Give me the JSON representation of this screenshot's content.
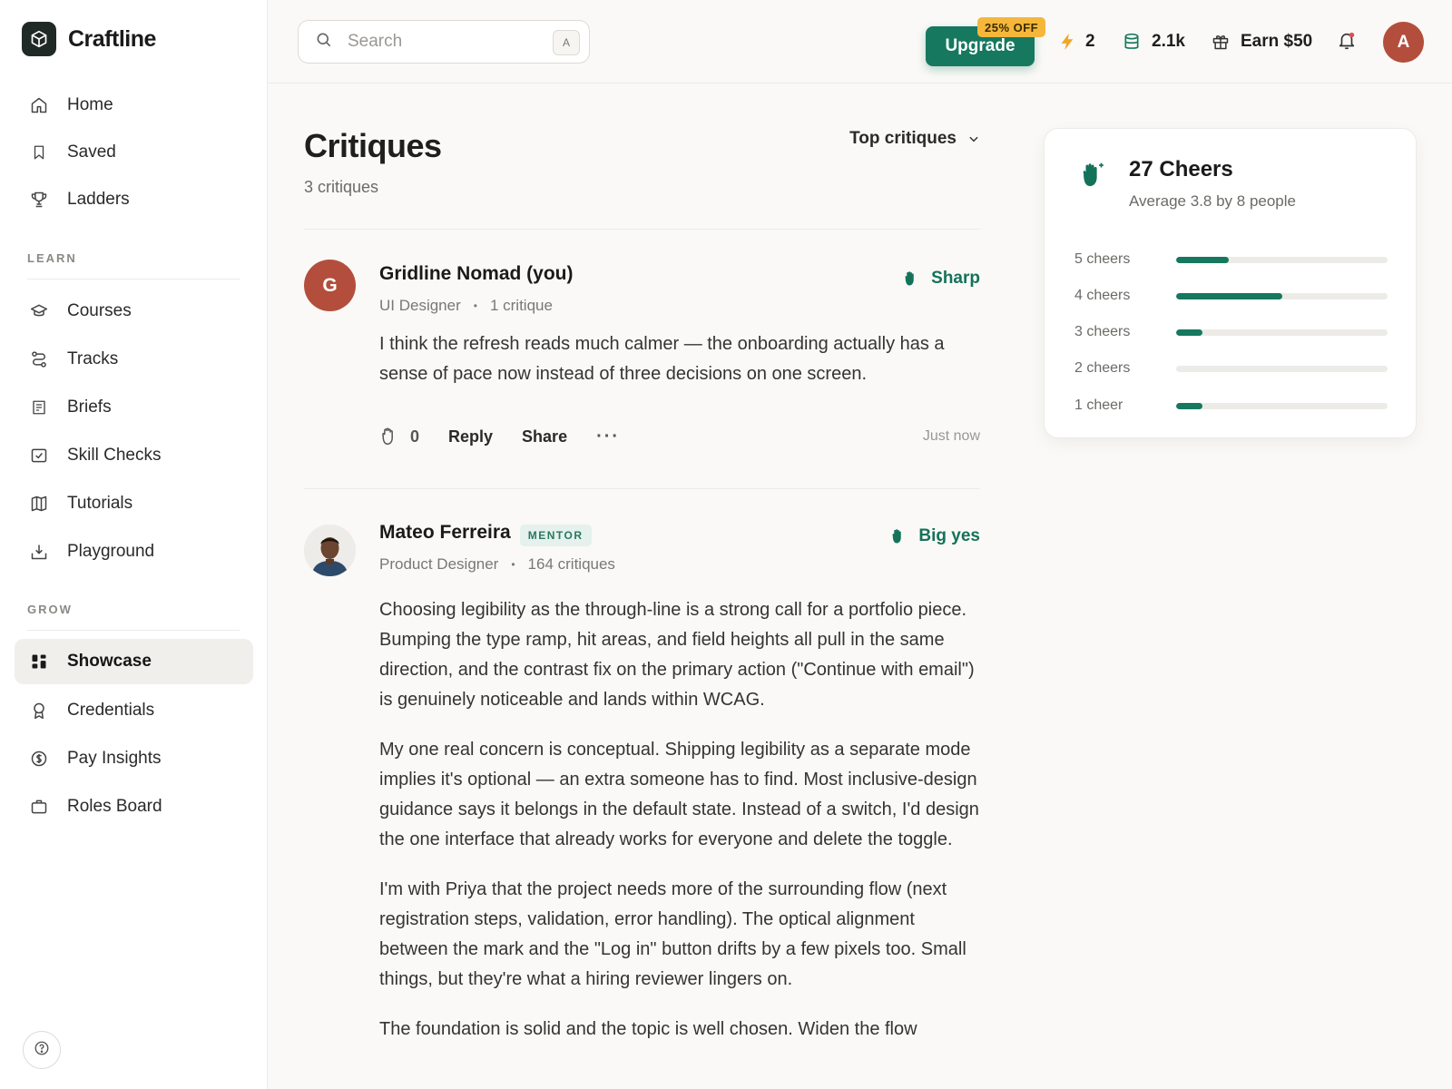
{
  "app": {
    "name": "Craftline"
  },
  "sidebar": {
    "nav_top": [
      {
        "label": "Home",
        "icon": "home-icon"
      },
      {
        "label": "Saved",
        "icon": "bookmark-icon"
      },
      {
        "label": "Ladders",
        "icon": "trophy-icon"
      }
    ],
    "section_learn": "LEARN",
    "nav_learn": [
      {
        "label": "Courses",
        "icon": "graduation-cap-icon"
      },
      {
        "label": "Tracks",
        "icon": "route-icon"
      },
      {
        "label": "Briefs",
        "icon": "document-icon"
      },
      {
        "label": "Skill Checks",
        "icon": "checkbox-icon"
      },
      {
        "label": "Tutorials",
        "icon": "map-icon"
      },
      {
        "label": "Playground",
        "icon": "upload-tray-icon"
      }
    ],
    "section_grow": "GROW",
    "nav_grow": [
      {
        "label": "Showcase",
        "icon": "grid-icon",
        "active": true
      },
      {
        "label": "Credentials",
        "icon": "award-icon"
      },
      {
        "label": "Pay Insights",
        "icon": "dollar-circle-icon"
      },
      {
        "label": "Roles Board",
        "icon": "briefcase-icon"
      }
    ]
  },
  "topbar": {
    "search_placeholder": "Search",
    "search_shortcut": "A",
    "upgrade_label": "Upgrade",
    "upgrade_badge": "25% OFF",
    "streak": "2",
    "coins": "2.1k",
    "earn": "Earn $50",
    "user_initial": "A"
  },
  "colors": {
    "accent": "#16785f",
    "avatar_user": "#b44e3c",
    "badge": "#f5b73b"
  },
  "page": {
    "title": "Critiques",
    "count": "3 critiques",
    "sort_label": "Top critiques"
  },
  "critiques": [
    {
      "initial": "G",
      "name": "Gridline Nomad (you)",
      "role": "UI Designer",
      "stats": "1 critique",
      "reaction": "Sharp",
      "paragraphs": [
        "I think the refresh reads much calmer — the onboarding actually has a sense of pace now instead of three decisions on one screen."
      ],
      "cheers": "0",
      "reply": "Reply",
      "share": "Share",
      "more": "···",
      "time": "Just now"
    },
    {
      "name": "Mateo Ferreira",
      "badge": "MENTOR",
      "role": "Product Designer",
      "stats": "164 critiques",
      "reaction": "Big yes",
      "paragraphs": [
        "Choosing legibility as the through-line is a strong call for a portfolio piece. Bumping the type ramp, hit areas, and field heights all pull in the same direction, and the contrast fix on the primary action (\"Continue with email\") is genuinely noticeable and lands within WCAG.",
        "My one real concern is conceptual. Shipping legibility as a separate mode implies it's optional — an extra someone has to find. Most inclusive-design guidance says it belongs in the default state. Instead of a switch, I'd design the one interface that already works for everyone and delete the toggle.",
        "I'm with Priya that the project needs more of the surrounding flow (next registration steps, validation, error handling). The optical alignment between the mark and the \"Log in\" button drifts by a few pixels too. Small things, but they're what a hiring reviewer lingers on.",
        "The foundation is solid and the topic is well chosen. Widen the flow"
      ]
    }
  ],
  "cheers_card": {
    "title": "27 Cheers",
    "subtitle": "Average 3.8 by 8 people",
    "rows": [
      {
        "label": "5 cheers",
        "fraction": 0.25
      },
      {
        "label": "4 cheers",
        "fraction": 0.5
      },
      {
        "label": "3 cheers",
        "fraction": 0.125
      },
      {
        "label": "2 cheers",
        "fraction": 0
      },
      {
        "label": "1 cheer",
        "fraction": 0.125
      }
    ]
  }
}
